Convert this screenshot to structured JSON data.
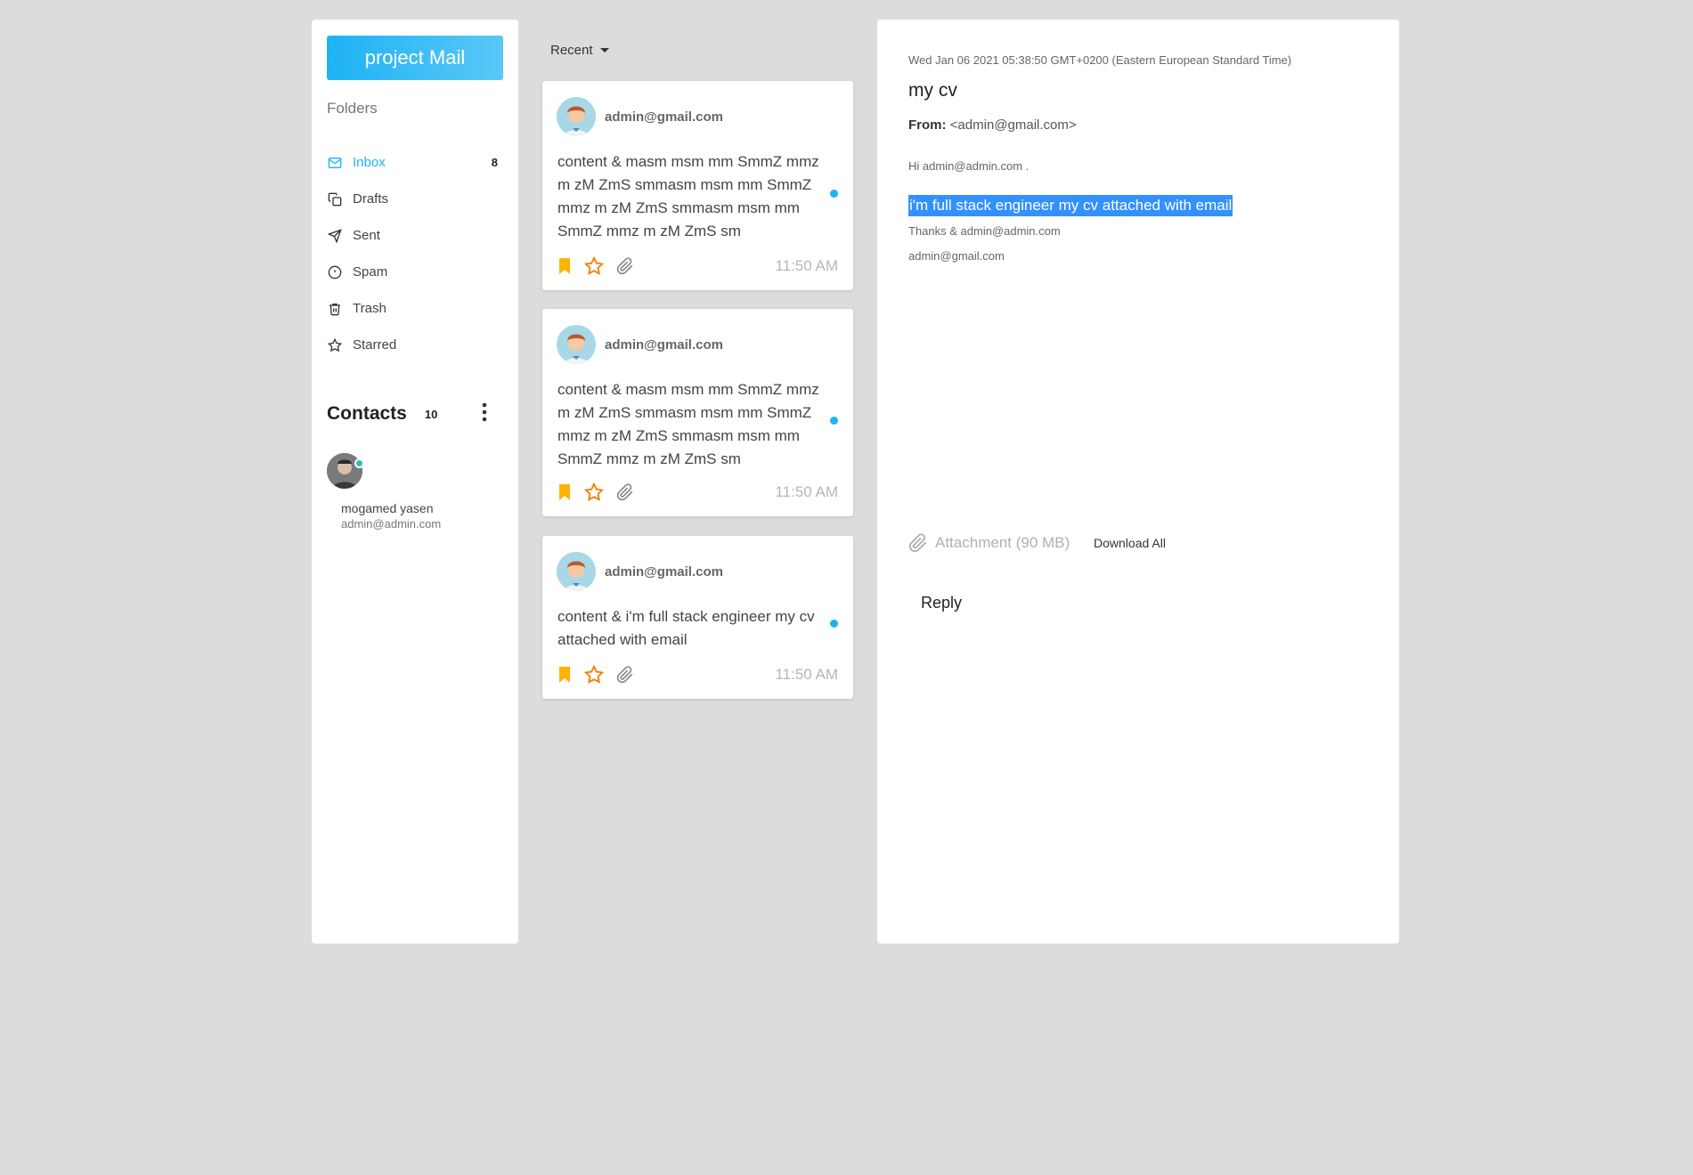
{
  "sidebar": {
    "compose_label": "project Mail",
    "folders_title": "Folders",
    "folders": [
      {
        "label": "Inbox",
        "icon": "mail-icon",
        "count": "8",
        "active": true
      },
      {
        "label": "Drafts",
        "icon": "copy-icon",
        "count": ""
      },
      {
        "label": "Sent",
        "icon": "send-icon",
        "count": ""
      },
      {
        "label": "Spam",
        "icon": "alert-circle-icon",
        "count": ""
      },
      {
        "label": "Trash",
        "icon": "trash-icon",
        "count": ""
      },
      {
        "label": "Starred",
        "icon": "star-icon",
        "count": ""
      }
    ],
    "contacts_title": "Contacts",
    "contacts_count": "10",
    "contact": {
      "name": "mogamed yasen",
      "email": "admin@admin.com"
    }
  },
  "list": {
    "filter_label": "Recent",
    "messages": [
      {
        "sender": "admin@gmail.com",
        "body": "content & masm msm mm SmmZ mmz m zM ZmS smmasm msm mm SmmZ mmz m zM ZmS smmasm msm mm SmmZ mmz m zM ZmS sm",
        "time": "11:50 AM"
      },
      {
        "sender": "admin@gmail.com",
        "body": "content & masm msm mm SmmZ mmz m zM ZmS smmasm msm mm SmmZ mmz m zM ZmS smmasm msm mm SmmZ mmz m zM ZmS sm",
        "time": "11:50 AM"
      },
      {
        "sender": "admin@gmail.com",
        "body": "content & i'm full stack engineer my cv attached with email",
        "time": "11:50 AM"
      }
    ]
  },
  "pane": {
    "date": "Wed Jan 06 2021 05:38:50 GMT+0200 (Eastern European Standard Time)",
    "subject": "my cv",
    "from_label": "From:",
    "from_value": "<admin@gmail.com>",
    "greeting": "Hi admin@admin.com .",
    "highlighted_text": "i'm full stack engineer my cv attached with email",
    "thanks": "Thanks & admin@admin.com",
    "signature": "admin@gmail.com",
    "attachment_label": "Attachment (90 MB)",
    "download_label": "Download All",
    "reply_label": "Reply"
  },
  "colors": {
    "accent": "#1eb2f5",
    "bookmark": "#ffb300",
    "star": "#f57c00",
    "highlight": "#3390ff"
  }
}
